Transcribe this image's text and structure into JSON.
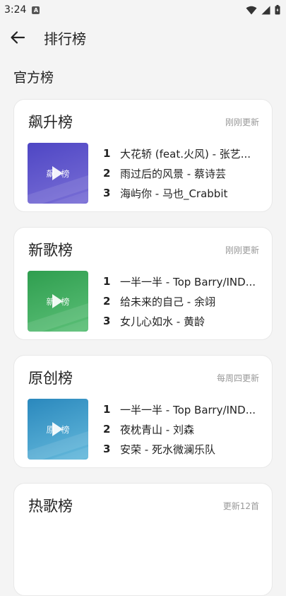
{
  "status": {
    "time": "3:24",
    "app_icon_letter": "A"
  },
  "appbar": {
    "title": "排行榜"
  },
  "section": {
    "title": "官方榜"
  },
  "charts": [
    {
      "title": "飙升榜",
      "update": "刚刚更新",
      "cover_left": "飙",
      "cover_right": "榜",
      "cover_color_top": "#5b4fc7",
      "cover_color_bottom": "#8a7ddb",
      "tracks": [
        {
          "rank": "1",
          "title": "大花轿 (feat.火风) - 张艺..."
        },
        {
          "rank": "2",
          "title": "雨过后的风景 - 蔡诗芸"
        },
        {
          "rank": "3",
          "title": "海屿你 - 马也_Crabbit"
        }
      ]
    },
    {
      "title": "新歌榜",
      "update": "刚刚更新",
      "cover_left": "新",
      "cover_right": "榜",
      "cover_color_top": "#35a456",
      "cover_color_bottom": "#5fc07b",
      "tracks": [
        {
          "rank": "1",
          "title": "一半一半 - Top Barry/IND..."
        },
        {
          "rank": "2",
          "title": "给未来的自己 - 余翊"
        },
        {
          "rank": "3",
          "title": "女儿心如水 - 黄龄"
        }
      ]
    },
    {
      "title": "原创榜",
      "update": "每周四更新",
      "cover_left": "原",
      "cover_right": "榜",
      "cover_color_top": "#2f8fc0",
      "cover_color_bottom": "#64b8db",
      "tracks": [
        {
          "rank": "1",
          "title": "一半一半 - Top Barry/IND..."
        },
        {
          "rank": "2",
          "title": "夜枕青山 - 刘森"
        },
        {
          "rank": "3",
          "title": "安荣 - 死水微澜乐队"
        }
      ]
    },
    {
      "title": "热歌榜",
      "update": "更新12首"
    }
  ]
}
